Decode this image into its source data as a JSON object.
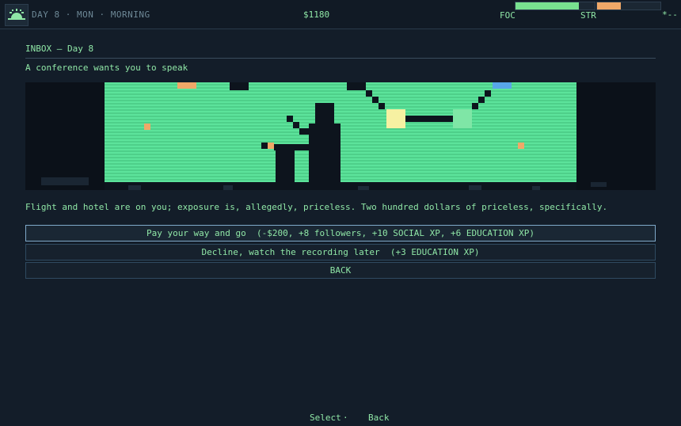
{
  "header": {
    "day_label": "DAY 8 · MON · MORNING",
    "money": "$1180",
    "stats": [
      {
        "label": "FOC",
        "level": 0.8,
        "color": "#78e08f"
      },
      {
        "label": "STR",
        "level": 0.375,
        "color": "#f0a868"
      }
    ],
    "corner_mark": "*--",
    "icon": "sunrise-icon"
  },
  "inbox": {
    "heading": "INBOX – Day 8",
    "subject": "A conference wants you to speak",
    "body": "Flight and hotel are on you; exposure is, allegedly, priceless. Two hundred dollars of priceless, specifically."
  },
  "options": [
    {
      "label": "Pay your way and go  (-$200, +8 followers, +10 SOCIAL XP, +6 EDUCATION XP)",
      "selected": true
    },
    {
      "label": "Decline, watch the recording later  (+3 EDUCATION XP)",
      "selected": false
    },
    {
      "label": "BACK",
      "selected": false
    }
  ],
  "footer": {
    "select": "Select",
    "separator": "·",
    "back": "Back"
  },
  "colors": {
    "background": "#131d29",
    "text": "#8fe6a6",
    "screen_green": "#5ce39b",
    "accent_orange": "#f0a868",
    "accent_blue": "#58a6e8",
    "highlight_yellow": "#f6f1a2"
  }
}
